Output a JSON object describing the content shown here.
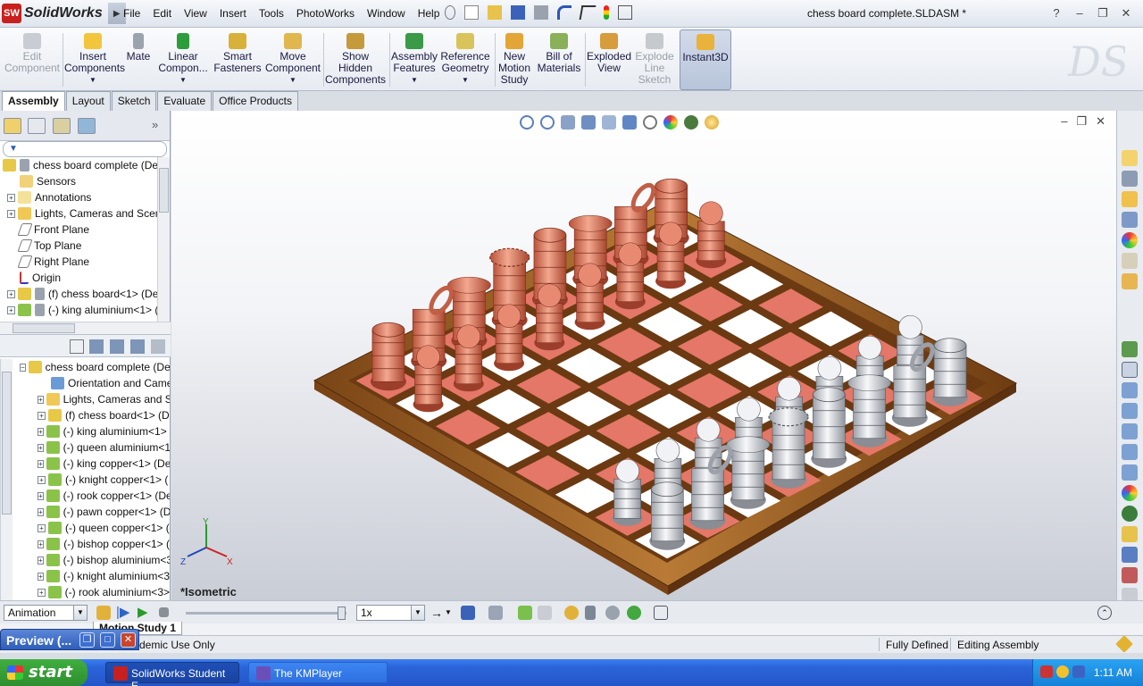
{
  "app": {
    "name": "SolidWorks",
    "logo_badge": "SW",
    "document_title": "chess board complete.SLDASM *"
  },
  "menu": [
    "File",
    "Edit",
    "View",
    "Insert",
    "Tools",
    "PhotoWorks",
    "Window",
    "Help"
  ],
  "ribbon": {
    "edit_component": "Edit Component",
    "insert_components": "Insert Components",
    "mate": "Mate",
    "linear_component": "Linear Compon...",
    "smart_fasteners": "Smart Fasteners",
    "move_component": "Move Component",
    "show_hidden": "Show Hidden Components",
    "assembly_features": "Assembly Features",
    "reference_geometry": "Reference Geometry",
    "new_motion_study": "New Motion Study",
    "bill_of_materials": "Bill of Materials",
    "exploded_view": "Exploded View",
    "explode_line_sketch": "Explode Line Sketch",
    "instant3d": "Instant3D"
  },
  "tabs": [
    "Assembly",
    "Layout",
    "Sketch",
    "Evaluate",
    "Office Products"
  ],
  "feature_tree": [
    {
      "label": "chess board complete  (Def",
      "expand": false
    },
    {
      "label": "Sensors",
      "expand": false
    },
    {
      "label": "Annotations",
      "expand": true
    },
    {
      "label": "Lights, Cameras and Scene",
      "expand": true
    },
    {
      "label": "Front Plane",
      "expand": false
    },
    {
      "label": "Top Plane",
      "expand": false
    },
    {
      "label": "Right Plane",
      "expand": false
    },
    {
      "label": "Origin",
      "expand": false
    },
    {
      "label": "(f) chess board<1> (De",
      "expand": true
    },
    {
      "label": "(-) king aluminium<1> (",
      "expand": true
    }
  ],
  "motion_tree": [
    {
      "label": "chess board complete  (Def",
      "expand": "-"
    },
    {
      "label": "Orientation and Camer",
      "expand": ""
    },
    {
      "label": "Lights, Cameras and Sc",
      "expand": "+"
    },
    {
      "label": "(f) chess board<1> (D",
      "expand": "+"
    },
    {
      "label": "(-) king aluminium<1> (",
      "expand": "+"
    },
    {
      "label": "(-) queen aluminium<1",
      "expand": "+"
    },
    {
      "label": "(-) king copper<1> (De",
      "expand": "+"
    },
    {
      "label": "(-) knight copper<1> (",
      "expand": "+"
    },
    {
      "label": "(-) rook copper<1> (De",
      "expand": "+"
    },
    {
      "label": "(-) pawn copper<1> (D",
      "expand": "+"
    },
    {
      "label": "(-) queen copper<1> (",
      "expand": "+"
    },
    {
      "label": "(-) bishop copper<1> (",
      "expand": "+"
    },
    {
      "label": "(-) bishop aluminium<3",
      "expand": "+"
    },
    {
      "label": "(-) knight aluminium<3",
      "expand": "+"
    },
    {
      "label": "(-) rook aluminium<3>",
      "expand": "+"
    }
  ],
  "viewport": {
    "view_label": "*Isometric",
    "axis_x": "X",
    "axis_y": "Y",
    "axis_z": "Z",
    "colors": {
      "copper": "#e07d63",
      "aluminium": "#d4d6dc",
      "board_red": "#e47767",
      "board_white": "#ffffff",
      "frame": "#a86a2a"
    }
  },
  "motion": {
    "study_type": "Animation",
    "playback_speed": "1x",
    "study_tab": "Motion Study 1"
  },
  "status": {
    "license": "SolidWorks Student Edition - Academic Use Only",
    "license_visible": "demic Use Only",
    "definition": "Fully Defined",
    "mode": "Editing Assembly"
  },
  "preview": {
    "title": "Preview (..."
  },
  "taskbar": {
    "start": "start",
    "tasks": [
      "SolidWorks Student E...",
      "The KMPlayer"
    ],
    "clock": "1:11 AM"
  }
}
